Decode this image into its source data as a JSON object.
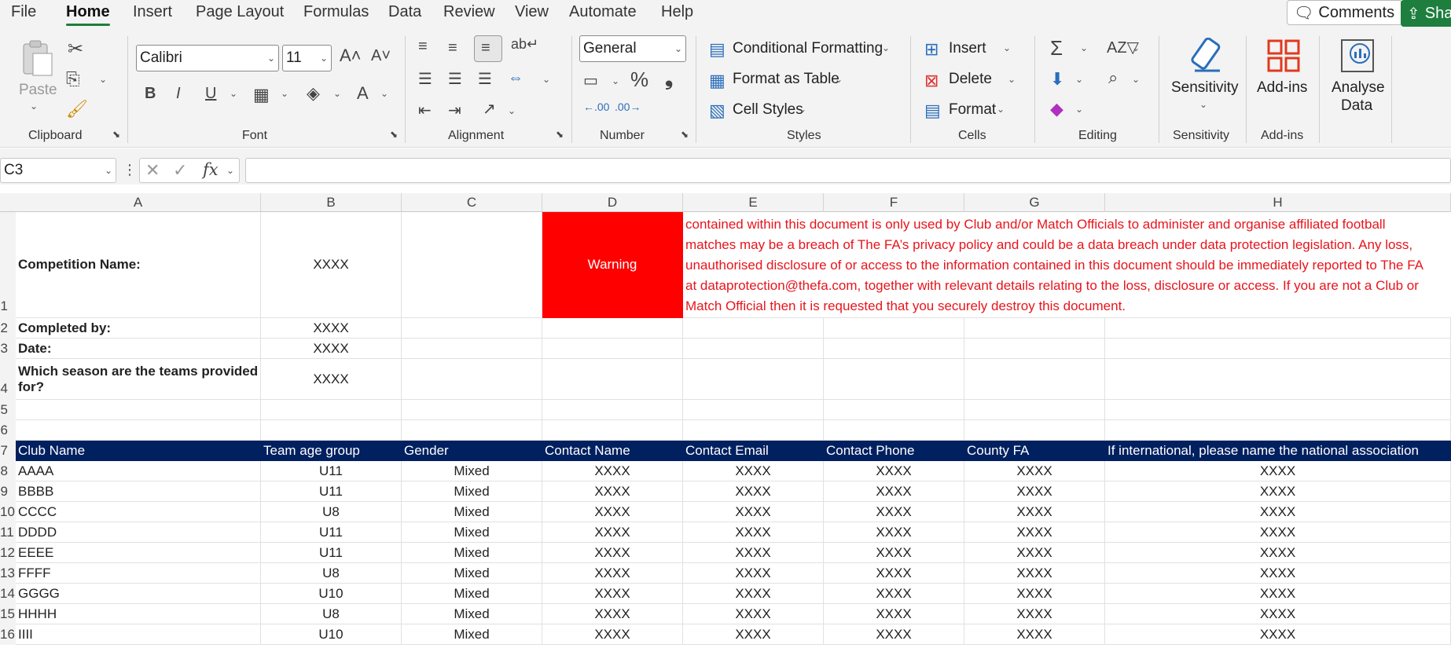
{
  "menu": {
    "items": [
      "File",
      "Home",
      "Insert",
      "Page Layout",
      "Formulas",
      "Data",
      "Review",
      "View",
      "Automate",
      "Help"
    ],
    "active": "Home",
    "comments": "Comments",
    "share": "Sha"
  },
  "ribbon": {
    "clipboard": {
      "paste": "Paste",
      "group": "Clipboard"
    },
    "font": {
      "name": "Calibri",
      "size": "11",
      "group": "Font"
    },
    "alignment": {
      "group": "Alignment"
    },
    "number": {
      "format": "General",
      "group": "Number"
    },
    "styles": {
      "conditional": "Conditional Formatting",
      "table": "Format as Table",
      "cell": "Cell Styles",
      "group": "Styles"
    },
    "cells": {
      "insert": "Insert",
      "delete": "Delete",
      "format": "Format",
      "group": "Cells"
    },
    "editing": {
      "group": "Editing"
    },
    "sensitivity": {
      "label": "Sensitivity",
      "group": "Sensitivity"
    },
    "addins": {
      "label": "Add-ins",
      "group": "Add-ins"
    },
    "analyse": {
      "label1": "Analyse",
      "label2": "Data"
    }
  },
  "formula_bar": {
    "name_box": "C3",
    "fx": "fx",
    "value": ""
  },
  "columns": [
    "A",
    "B",
    "C",
    "D",
    "E",
    "F",
    "G",
    "H"
  ],
  "rows": {
    "numbers": [
      "1",
      "2",
      "3",
      "4",
      "5",
      "6",
      "7",
      "8",
      "9",
      "10",
      "11",
      "12",
      "13",
      "14",
      "15",
      "16"
    ]
  },
  "info": {
    "competition_label": "Competition Name:",
    "competition_value": "XXXX",
    "completed_label": "Completed by:",
    "completed_value": "XXXX",
    "date_label": "Date:",
    "date_value": "XXXX",
    "season_label_1": "Which season are the teams provided",
    "season_label_2": "for?",
    "season_value": "XXXX",
    "warning": "Warning",
    "warning_lines": [
      "contained within this document is only used by Club and/or Match Officials to administer and organise affiliated football",
      "matches may be a breach of The FA’s privacy policy and could be a data breach under data protection legislation. Any loss,",
      "unauthorised disclosure of or access to the information contained in this document should be immediately reported to The FA",
      "at dataprotection@thefa.com, together with relevant details relating to the loss, disclosure or access. If you are not a Club or",
      "Match Official then it is requested that you securely destroy this document."
    ]
  },
  "table": {
    "headers": [
      "Club Name",
      "Team age group",
      "Gender",
      "Contact Name",
      "Contact Email",
      "Contact Phone",
      "County FA",
      "If international, please name the national association"
    ],
    "rows": [
      [
        "AAAA",
        "U11",
        "Mixed",
        "XXXX",
        "XXXX",
        "XXXX",
        "XXXX",
        "XXXX"
      ],
      [
        "BBBB",
        "U11",
        "Mixed",
        "XXXX",
        "XXXX",
        "XXXX",
        "XXXX",
        "XXXX"
      ],
      [
        "CCCC",
        "U8",
        "Mixed",
        "XXXX",
        "XXXX",
        "XXXX",
        "XXXX",
        "XXXX"
      ],
      [
        "DDDD",
        "U11",
        "Mixed",
        "XXXX",
        "XXXX",
        "XXXX",
        "XXXX",
        "XXXX"
      ],
      [
        "EEEE",
        "U11",
        "Mixed",
        "XXXX",
        "XXXX",
        "XXXX",
        "XXXX",
        "XXXX"
      ],
      [
        "FFFF",
        "U8",
        "Mixed",
        "XXXX",
        "XXXX",
        "XXXX",
        "XXXX",
        "XXXX"
      ],
      [
        "GGGG",
        "U10",
        "Mixed",
        "XXXX",
        "XXXX",
        "XXXX",
        "XXXX",
        "XXXX"
      ],
      [
        "HHHH",
        "U8",
        "Mixed",
        "XXXX",
        "XXXX",
        "XXXX",
        "XXXX",
        "XXXX"
      ],
      [
        "IIII",
        "U10",
        "Mixed",
        "XXXX",
        "XXXX",
        "XXXX",
        "XXXX",
        "XXXX"
      ]
    ]
  },
  "colors": {
    "accent": "#1e7e3e",
    "header_fill": "#002060",
    "warning_fill": "#ff0000",
    "warning_text": "#e8141c"
  }
}
